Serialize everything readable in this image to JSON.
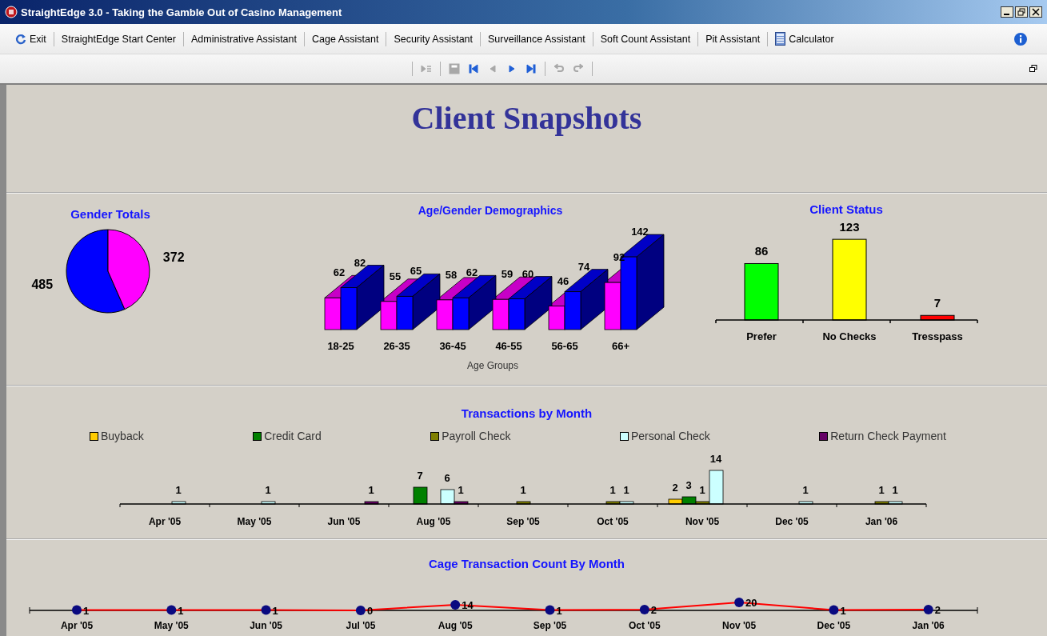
{
  "window": {
    "title": "StraightEdge 3.0 - Taking the Gamble Out of Casino Management"
  },
  "menu": [
    {
      "label": "Exit",
      "kind": "exit"
    },
    {
      "label": "StraightEdge Start Center",
      "kind": "text"
    },
    {
      "label": "Administrative Assistant",
      "kind": "text"
    },
    {
      "label": "Cage Assistant",
      "kind": "text"
    },
    {
      "label": "Security Assistant",
      "kind": "text"
    },
    {
      "label": "Surveillance Assistant",
      "kind": "text"
    },
    {
      "label": "Soft Count Assistant",
      "kind": "text"
    },
    {
      "label": "Pit Assistant",
      "kind": "text"
    },
    {
      "label": "Calculator",
      "kind": "calculator"
    }
  ],
  "toolbar": [
    {
      "buttons": [
        {
          "kind": "play",
          "disabled": true
        }
      ]
    },
    {
      "buttons": [
        {
          "kind": "save",
          "disabled": true
        },
        {
          "kind": "first",
          "disabled": false
        },
        {
          "kind": "prev",
          "disabled": true
        },
        {
          "kind": "next",
          "disabled": false
        },
        {
          "kind": "last",
          "disabled": false
        }
      ]
    },
    {
      "buttons": [
        {
          "kind": "undo",
          "disabled": true
        },
        {
          "kind": "redo",
          "disabled": true
        }
      ]
    }
  ],
  "page_title": "Client Snapshots",
  "gender": {
    "chart_data": {
      "type": "pie",
      "title": "Gender Totals",
      "values": [
        485,
        372
      ],
      "colors": [
        "#0000ff",
        "#ff00ff"
      ],
      "data_labels": true
    }
  },
  "demographics": {
    "chart_data": {
      "type": "bar",
      "title": "Age/Gender Demographics",
      "xlabel": "Age Groups",
      "categories": [
        "18-25",
        "26-35",
        "36-45",
        "46-55",
        "56-65",
        "66+"
      ],
      "series": [
        {
          "color": "#ff00ff",
          "values": [
            62,
            55,
            58,
            59,
            46,
            92
          ]
        },
        {
          "color": "#0000ff",
          "values": [
            82,
            65,
            62,
            60,
            74,
            142
          ]
        }
      ],
      "data_labels": true
    }
  },
  "client_status": {
    "chart_data": {
      "type": "bar",
      "title": "Client Status",
      "categories": [
        "Prefer",
        "No Checks",
        "Tresspass"
      ],
      "series": [
        {
          "color": "#00ff00",
          "values": [
            86,
            null,
            null
          ]
        },
        {
          "color": "#ffff00",
          "values": [
            null,
            123,
            null
          ]
        },
        {
          "color": "#ff0000",
          "values": [
            null,
            null,
            7
          ]
        }
      ],
      "data_labels": true
    }
  },
  "transactions": {
    "chart_data": {
      "type": "bar",
      "title": "Transactions by Month",
      "categories": [
        "Apr '05",
        "May '05",
        "Jun '05",
        "Aug '05",
        "Sep '05",
        "Oct '05",
        "Nov '05",
        "Dec '05",
        "Jan '06"
      ],
      "series": [
        {
          "name": "Buyback",
          "color": "#ffcc00",
          "values": [
            null,
            null,
            null,
            null,
            null,
            null,
            2,
            null,
            null
          ]
        },
        {
          "name": "Credit Card",
          "color": "#008000",
          "values": [
            null,
            null,
            null,
            7,
            null,
            null,
            3,
            null,
            null
          ]
        },
        {
          "name": "Payroll Check",
          "color": "#808000",
          "values": [
            null,
            null,
            null,
            null,
            1,
            1,
            1,
            null,
            1
          ]
        },
        {
          "name": "Personal Check",
          "color": "#ccffff",
          "values": [
            1,
            1,
            null,
            6,
            null,
            1,
            14,
            1,
            1
          ]
        },
        {
          "name": "Return Check Payment",
          "color": "#660066",
          "values": [
            null,
            null,
            1,
            1,
            null,
            null,
            null,
            null,
            null
          ]
        }
      ],
      "legend": true,
      "data_labels": true
    }
  },
  "cage": {
    "chart_data": {
      "type": "line",
      "title": "Cage Transaction Count By Month",
      "categories": [
        "Apr '05",
        "May '05",
        "Jun '05",
        "Jul '05",
        "Aug '05",
        "Sep '05",
        "Oct '05",
        "Nov '05",
        "Dec '05",
        "Jan '06"
      ],
      "series": [
        {
          "color": "#ff0000",
          "marker": "o",
          "values": [
            1,
            1,
            1,
            0,
            14,
            1,
            2,
            20,
            1,
            2
          ]
        }
      ],
      "data_labels": true
    }
  }
}
